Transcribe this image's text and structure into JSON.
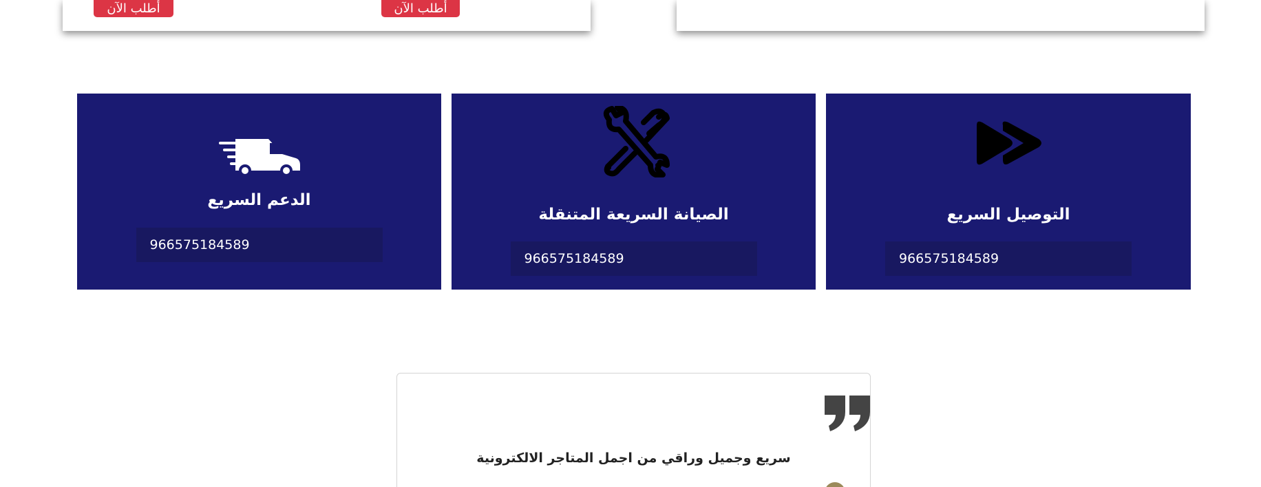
{
  "top_cards": {
    "order_button_label": "أطلب الآن"
  },
  "services": [
    {
      "title": "الدعم السريع",
      "phone": "966575184589",
      "icon": "delivery-van-icon"
    },
    {
      "title": "الصيانة السريعة المتنقلة",
      "phone": "966575184589",
      "icon": "tools-icon"
    },
    {
      "title": "التوصيل السريع",
      "phone": "966575184589",
      "icon": "fast-forward-icon"
    }
  ],
  "testimonial": {
    "text": "سريع وجميل وراقي من اجمل المتاجر الالكترونية",
    "icon": "quote-icon"
  },
  "colors": {
    "service_bg": "#1a1a72",
    "phone_bg": "#181860",
    "order_button": "#dc3545"
  }
}
